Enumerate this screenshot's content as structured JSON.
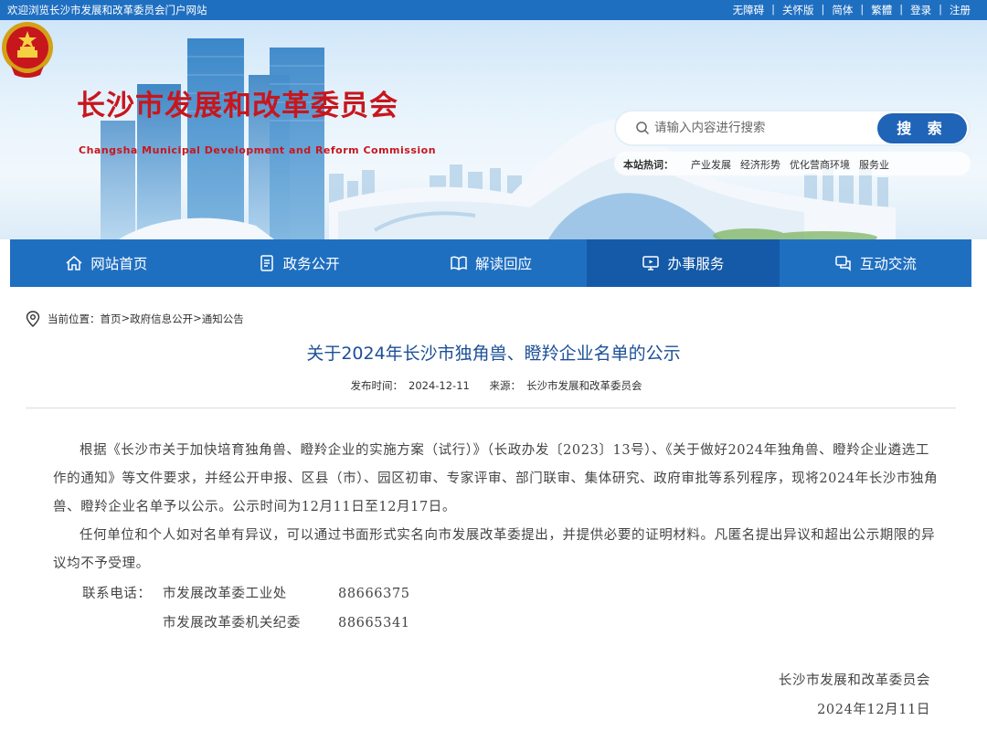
{
  "topbar": {
    "welcome": "欢迎浏览长沙市发展和改革委员会门户网站",
    "links": [
      "无障碍",
      "关怀版",
      "简体",
      "繁體",
      "登录",
      "注册"
    ]
  },
  "header": {
    "title_cn": "长沙市发展和改革委员会",
    "title_en": "Changsha Municipal Development and Reform Commission"
  },
  "search": {
    "placeholder": "请输入内容进行搜索",
    "button": "搜 索",
    "hot_label": "本站热词：",
    "hot_words": [
      "产业发展",
      "经济形势",
      "优化营商环境",
      "服务业"
    ]
  },
  "nav": {
    "items": [
      {
        "label": "网站首页",
        "icon": "home-icon"
      },
      {
        "label": "政务公开",
        "icon": "document-icon"
      },
      {
        "label": "解读回应",
        "icon": "book-icon"
      },
      {
        "label": "办事服务",
        "icon": "monitor-icon"
      },
      {
        "label": "互动交流",
        "icon": "chat-icon"
      }
    ],
    "active_index": 3
  },
  "breadcrumb": {
    "prefix": "当前位置：",
    "items": [
      "首页",
      ">",
      "政府信息公开",
      ">",
      "通知公告"
    ]
  },
  "article": {
    "title": "关于2024年长沙市独角兽、瞪羚企业名单的公示",
    "date_label": "发布时间：",
    "date": "2024-12-11",
    "source_label": "来源：",
    "source": "长沙市发展和改革委员会",
    "paragraphs": [
      "根据《长沙市关于加快培育独角兽、瞪羚企业的实施方案（试行）》（长政办发〔2023〕13号）、《关于做好2024年独角兽、瞪羚企业遴选工作的通知》等文件要求，并经公开申报、区县（市）、园区初审、专家评审、部门联审、集体研究、政府审批等系列程序，现将2024年长沙市独角兽、瞪羚企业名单予以公示。公示时间为12月11日至12月17日。",
      "任何单位和个人如对名单有异议，可以通过书面形式实名向市发展改革委提出，并提供必要的证明材料。凡匿名提出异议和超出公示期限的异议均不予受理。"
    ],
    "contact_label": "联系电话：",
    "contacts": [
      {
        "dept": "市发展改革委工业处",
        "phone": "88666375"
      },
      {
        "dept": "市发展改革委机关纪委",
        "phone": "88665341"
      }
    ],
    "signature": "长沙市发展和改革委员会",
    "sign_date": "2024年12月11日"
  },
  "colors": {
    "primary_blue": "#1f6fc1",
    "active_nav": "#145aa8",
    "title_red": "#c8161d",
    "article_title": "#1c4f96"
  }
}
